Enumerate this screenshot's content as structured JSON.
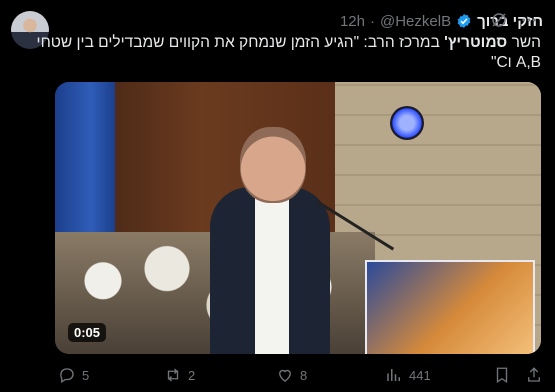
{
  "tweet": {
    "author_name": "חזקי ברוך",
    "handle": "@HezkelB",
    "separator": "·",
    "time": "12h",
    "text_prefix": "השר ",
    "text_bold": "סמוטריץ'",
    "text_rest": " במרכז הרב: \"הגיע הזמן שנמחק את הקווים שמבדילים בין שטחי",
    "text_line2": "A,B וC\""
  },
  "media": {
    "duration": "0:05"
  },
  "actions": {
    "replies": "5",
    "reposts": "2",
    "likes": "8",
    "views": "441"
  },
  "colors": {
    "background": "#000000",
    "text": "#e7e9ea",
    "muted": "#71767b",
    "verified": "#1d9bf0"
  }
}
